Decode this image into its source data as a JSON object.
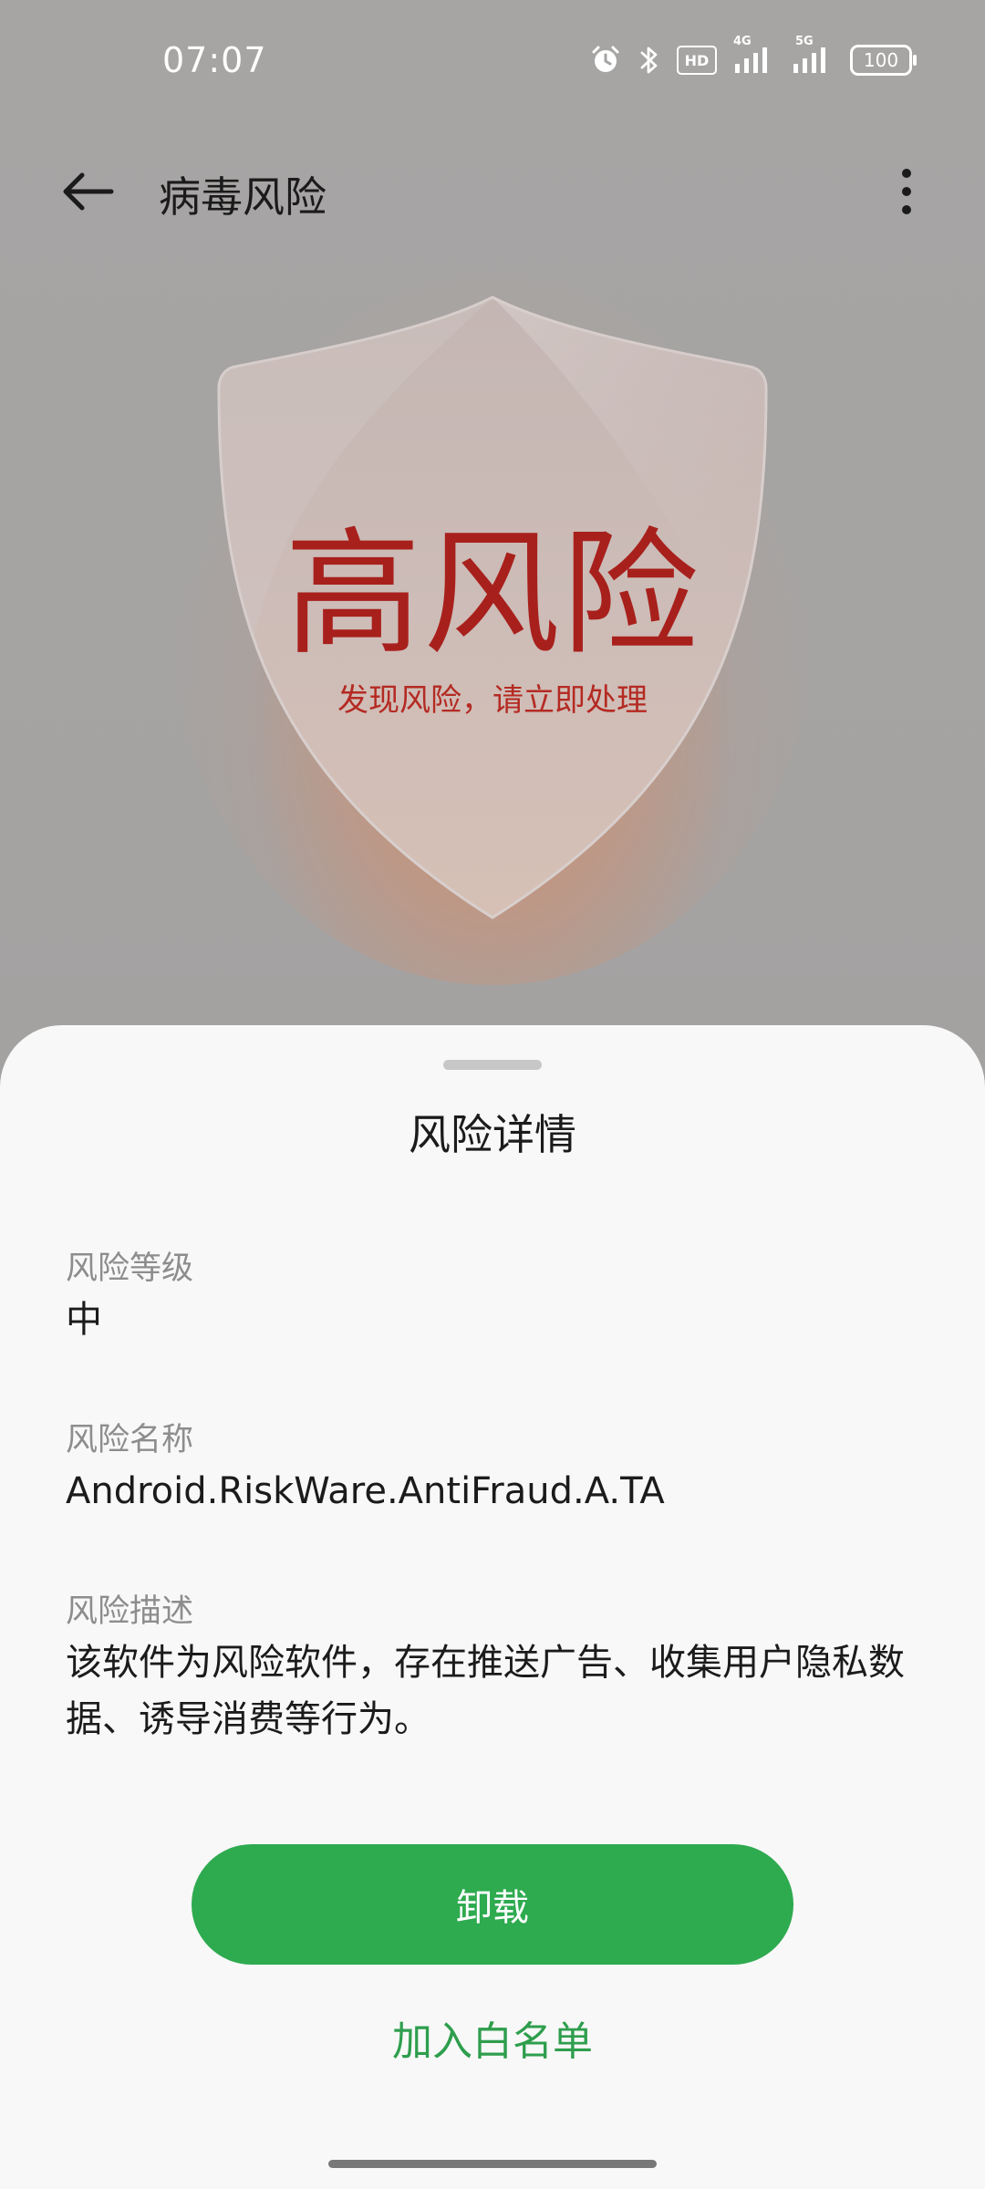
{
  "status_bar": {
    "time": "07:07",
    "hd_label": "HD",
    "network_4g": "4G",
    "network_5g": "5G",
    "battery": "100"
  },
  "app_bar": {
    "title": "病毒风险",
    "back_icon": "arrow-left-icon",
    "more_icon": "more-vertical-icon"
  },
  "hero": {
    "risk_level": "高风险",
    "risk_message": "发现风险，请立即处理",
    "accent_color": "#a8201c"
  },
  "sheet": {
    "title": "风险详情",
    "fields": [
      {
        "label": "风险等级",
        "value": "中"
      },
      {
        "label": "风险名称",
        "value": "Android.RiskWare.AntiFraud.A.TA"
      },
      {
        "label": "风险描述",
        "value": "该软件为风险软件，存在推送广告、收集用户隐私数据、诱导消费等行为。"
      }
    ],
    "primary_button": "卸载",
    "secondary_link": "加入白名单",
    "primary_color": "#2eaa4f"
  }
}
